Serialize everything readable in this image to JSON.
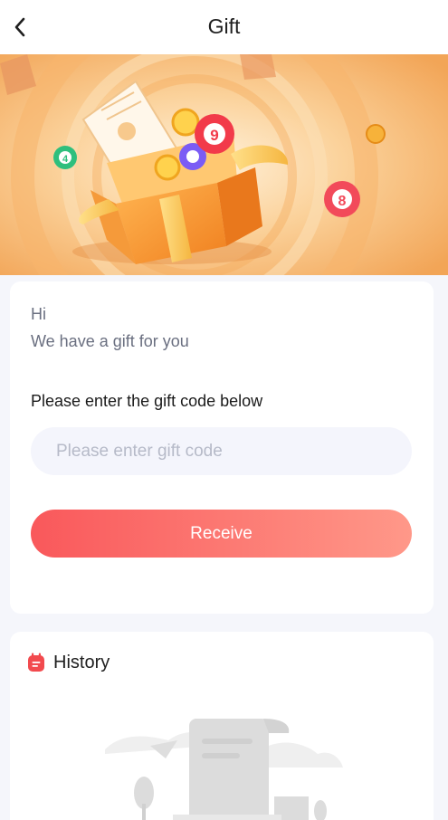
{
  "header": {
    "title": "Gift"
  },
  "banner": {
    "ball_numbers": [
      "9",
      "4",
      "8"
    ]
  },
  "gift": {
    "greeting": "Hi",
    "subtitle": "We have a gift for you",
    "prompt": "Please enter the gift code below",
    "input_placeholder": "Please enter gift code",
    "input_value": "",
    "receive_label": "Receive"
  },
  "history": {
    "title": "History"
  },
  "colors": {
    "accent_start": "#f9585b",
    "accent_end": "#ff9889",
    "page_bg": "#f5f6fb",
    "banner_orange": "#f6b46a"
  },
  "icons": {
    "back": "back-chevron-icon",
    "history": "history-calendar-icon"
  }
}
